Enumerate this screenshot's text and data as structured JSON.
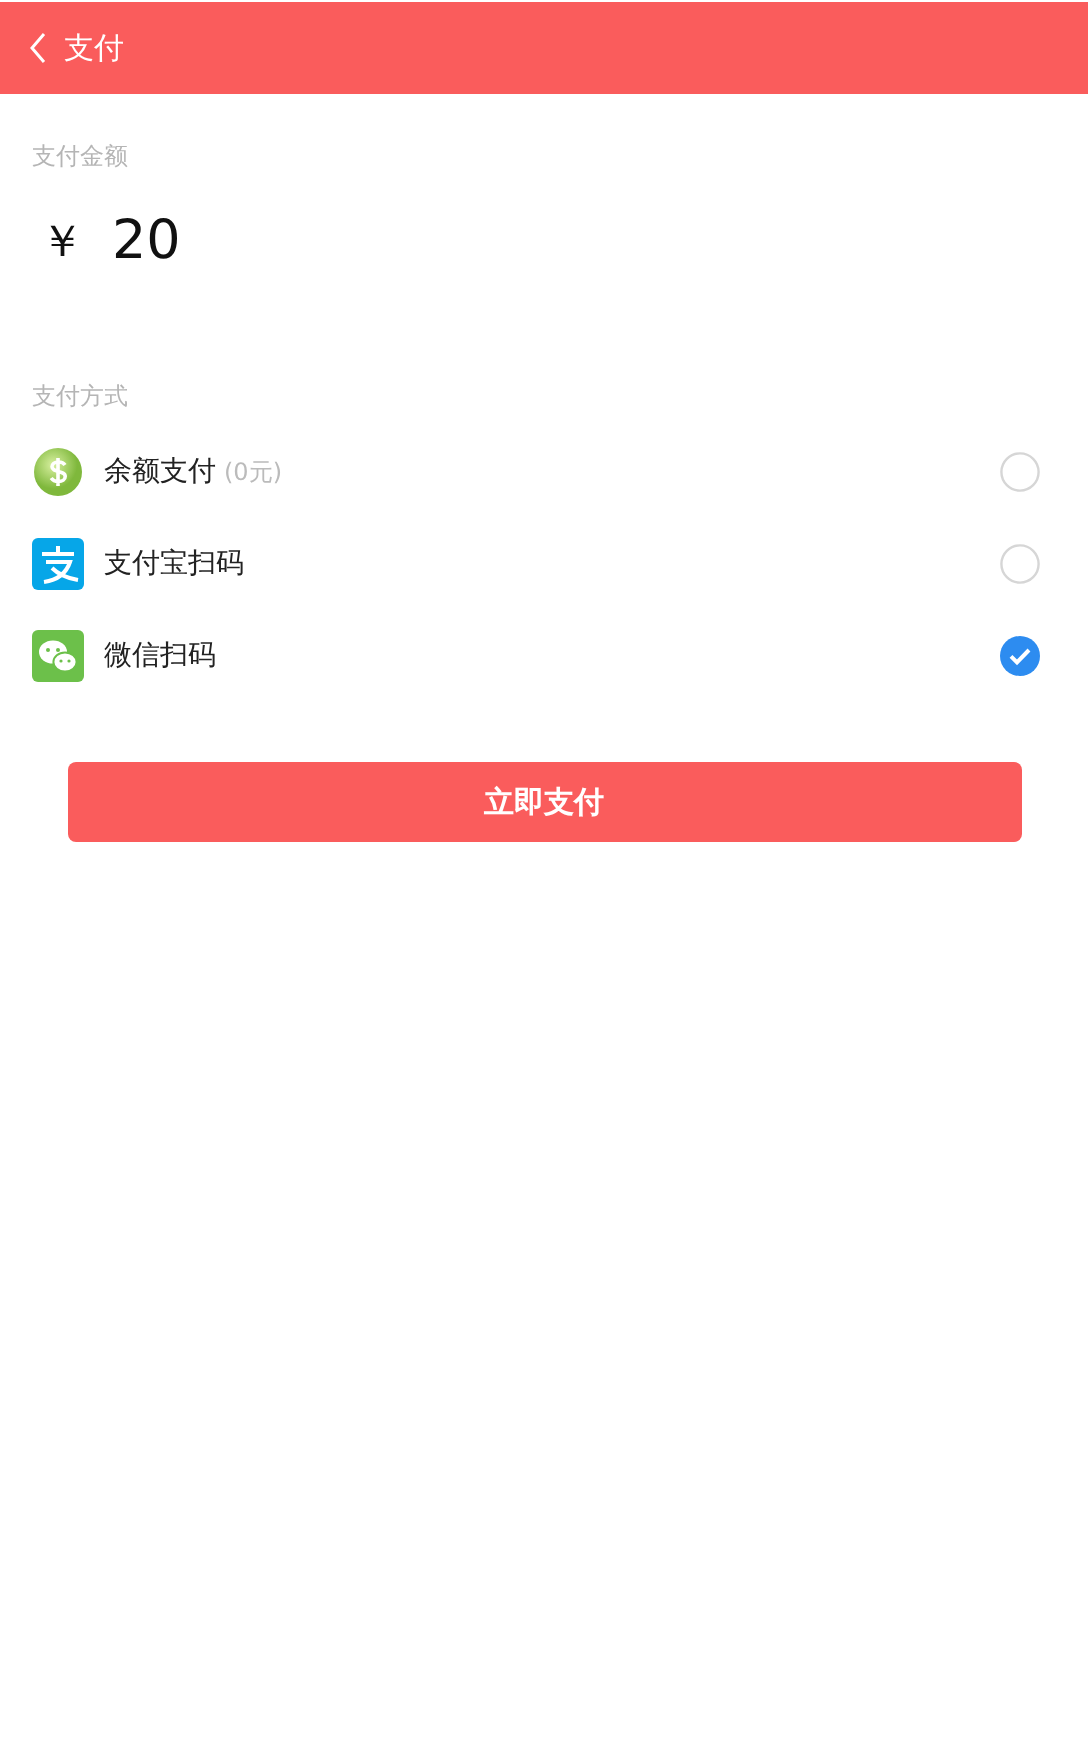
{
  "header": {
    "title": "支付"
  },
  "amount": {
    "label": "支付金额",
    "currency": "￥",
    "value": "20"
  },
  "methods_label": "支付方式",
  "methods": [
    {
      "kind": "balance",
      "name": "余额支付",
      "note": "(0元)",
      "selected": false
    },
    {
      "kind": "alipay",
      "name": "支付宝扫码",
      "selected": false
    },
    {
      "kind": "wechat",
      "name": "微信扫码",
      "selected": true
    }
  ],
  "pay_button": "立即支付"
}
